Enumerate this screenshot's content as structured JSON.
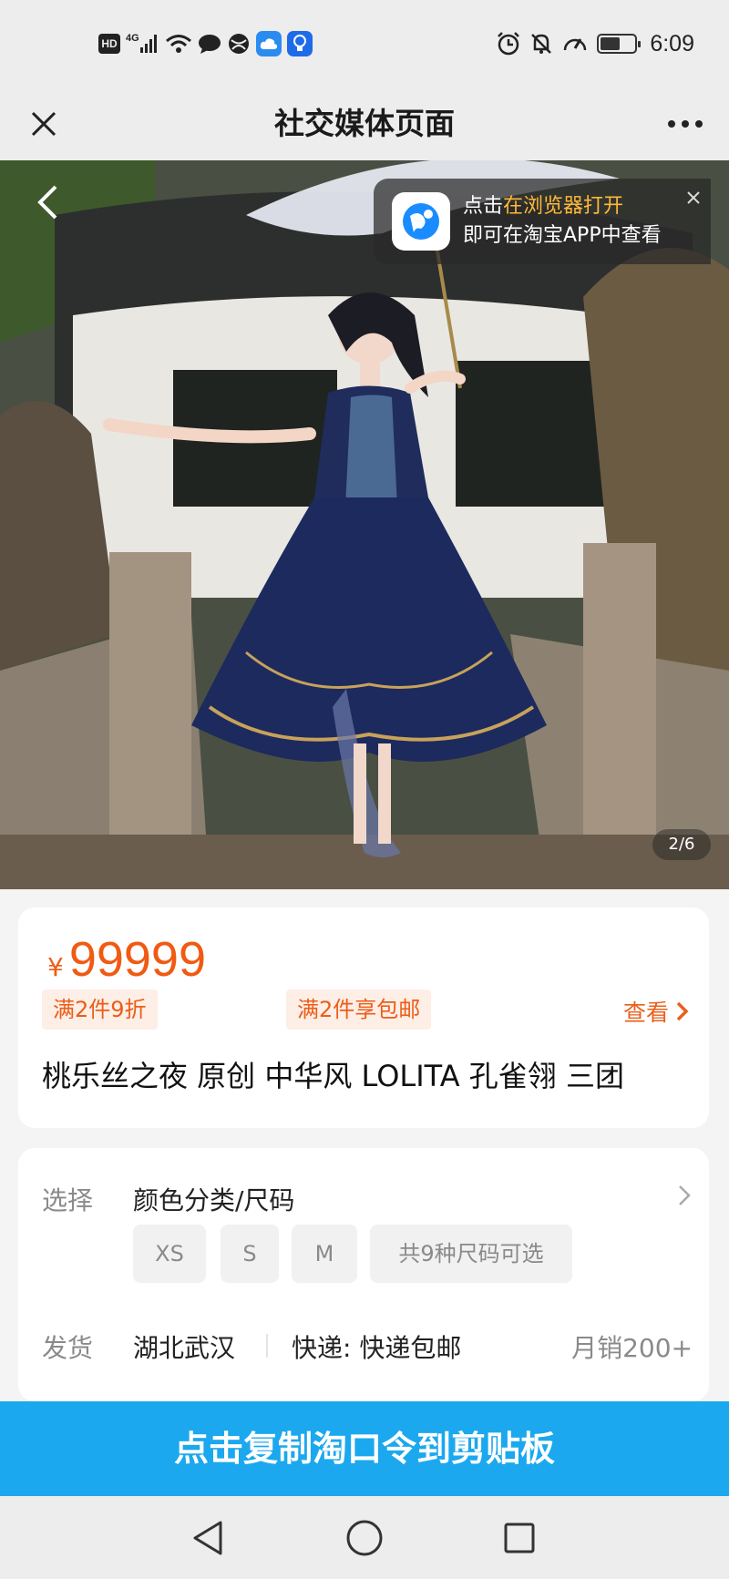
{
  "status_bar": {
    "hd_label": "HD",
    "network_label": "4G",
    "time": "6:09",
    "battery_level": 0.6,
    "icons": [
      "hd-icon",
      "signal-icon",
      "wifi-icon",
      "chat-bubble-icon",
      "globe-icon",
      "cloud-icon",
      "lightbulb-icon",
      "alarm-icon",
      "mute-icon",
      "speedometer-icon",
      "battery-icon"
    ]
  },
  "title_bar": {
    "title": "社交媒体页面",
    "icons": [
      "close-icon",
      "more-icon"
    ]
  },
  "hero": {
    "banner_line1_prefix": "点击",
    "banner_line1_highlight": "在浏览器打开",
    "banner_line2": "即可在淘宝APP中查看",
    "image_counter": "2/6",
    "colors": {
      "banner_highlight": "#ffb938"
    }
  },
  "product": {
    "currency": "¥",
    "price": "99999",
    "promo_1": "满2件9折",
    "promo_2": "满2件享包邮",
    "view_label": "查看",
    "title": "桃乐丝之夜 原创 中华风 LOLITA 孔雀翎 三团",
    "colors": {
      "price": "#f05a12",
      "promo_bg": "#fdeee6"
    }
  },
  "options": {
    "select_label": "选择",
    "select_value": "颜色分类/尺码",
    "sizes": [
      "XS",
      "S",
      "M"
    ],
    "size_more": "共9种尺码可选",
    "ship_label": "发货",
    "ship_origin": "湖北武汉",
    "express": "快递: 快递包邮",
    "monthly_sales": "月销200+"
  },
  "cta": {
    "label": "点击复制淘口令到剪贴板",
    "color": "#1ba8ee"
  },
  "nav_bar": {
    "icons": [
      "back-triangle-icon",
      "home-circle-icon",
      "recents-square-icon"
    ]
  }
}
